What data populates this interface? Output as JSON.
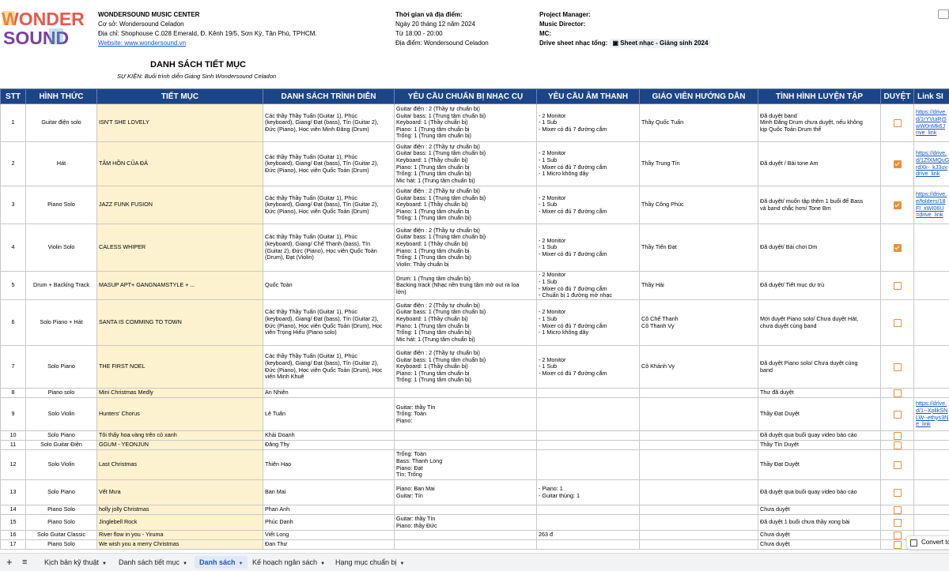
{
  "brand": {
    "logo_line1": "WONDER",
    "logo_line2": "SOUND"
  },
  "info": {
    "center_name": "WONDERSOUND MUSIC CENTER",
    "branch": "Cơ sở: Wondersound Celadon",
    "address": "Địa chỉ: Shophouse C.028 Emerald, Đ. Kênh 19/5, Sơn Kỳ, Tân Phú, TPHCM.",
    "website_label": "Website: ",
    "website": "www.wondersound.vn",
    "time_place_label": "Thời gian và địa điểm:",
    "date": "Ngày 20 tháng 12 năm 2024",
    "time": "Từ 18:00 - 20:00",
    "venue": "Địa điểm: Wondersound Celadon",
    "pm_label": "Project Manager:",
    "md_label": "Music Director:",
    "mc_label": "MC:",
    "drive_label": "Drive sheet nhạc tổng:",
    "drive_chip": "Sheet nhạc - Giáng sinh 2024"
  },
  "sheet_title": "DANH SÁCH TIẾT MỤC",
  "sheet_subtitle": "SỰ KIỆN: Buổi trình diễn Giáng Sinh Wondersound Celadon",
  "columns": [
    "STT",
    "HÌNH THỨC",
    "TIẾT MỤC",
    "DANH SÁCH TRÌNH DIỄN",
    "YÊU CẦU CHUẨN BỊ NHẠC CỤ",
    "YÊU CẦU ÂM THANH",
    "GIÁO VIÊN HƯỚNG DẪN",
    "TÌNH HÌNH LUYỆN TẬP",
    "DUYỆT",
    "Link SI"
  ],
  "rows": [
    {
      "stt": "1",
      "form": "Guitar điện solo",
      "piece": "ISN'T SHE LOVELY",
      "performers": "Các thầy Thầy Tuấn (Guitar 1), Phúc\n(keyboard), Giang/ Đạt (bass), Tín (Guitar 2),\nĐức (Piano), Học viên Minh Đăng (Drum)",
      "instruments": "Guitar điện : 2 (Thầy tự chuẩn bị)\nGuitar bass: 1 (Trung tâm chuẩn bị)\nKeyboard: 1 (Thầy chuẩn bị)\nPiano: 1 (Trung tâm chuẩn bị\nTrống: 1 (Trung tâm chuẩn bị)",
      "sound": "- 2 Monitor\n- 1 Sub\n- Mixer có đủ 7 đường cắm",
      "teacher": "Thầy Quốc Tuấn",
      "practice": "Đã duyệt band\nMinh Đăng Drum chưa duyệt, nếu không\nkịp Quốc Toản Drum thế",
      "approved": false,
      "link": "https://drive.\nd/1rYVuiRjS\nwW0nMk6J\nrive_link"
    },
    {
      "stt": "2",
      "form": "Hát",
      "piece": "TÂM HỒN CỦA ĐÁ",
      "performers": "Các thầy Thầy Tuấn (Guitar 1), Phúc\n(keyboard), Giang/ Đạt (bass), Tín (Guitar 2),\nĐức (Piano), Học viên Quốc Toản (Drum)",
      "instruments": "Guitar điện : 2 (Thầy tự chuẩn bị)\nGuitar bass: 1 (Trung tâm chuẩn bị)\nKeyboard: 1 (Thầy chuẩn bị)\nPiano: 1 (Trung tâm chuẩn bị\nTrống: 1 (Trung tâm chuẩn bị)\nMic hát: 1 (Trung tâm chuẩn bị)",
      "sound": "- 2 Monitor\n- 1 Sub\n- Mixer có đủ 7 đường cắm\n- 1 Micro không dây",
      "teacher": "Thầy Trung Tín",
      "practice": "Đã duyệt / Bài tone Am",
      "approved": true,
      "link": "https://drive.\nd/1ZfXMQuG\nrdXk-_kJ3uv\ndrive_link"
    },
    {
      "stt": "3",
      "form": "Piano Solo",
      "piece": "JAZZ FUNK FUSION",
      "performers": "Các thầy Thầy Tuấn (Guitar 1), Phúc\n(keyboard), Giang/ Đạt (bass), Tín (Guitar 2),\nĐức (Piano), Học viên Quốc Toản (Drum)",
      "instruments": "Guitar điện : 2 (Thầy tự chuẩn bị)\nGuitar bass: 1 (Trung tâm chuẩn bị)\nKeyboard: 1 (Thầy chuẩn bị)\nPiano: 1 (Trung tâm chuẩn bị\nTrống: 1 (Trung tâm chuẩn bị)",
      "sound": "- 2 Monitor\n- 1 Sub\n- Mixer có đủ 7 đường cắm",
      "teacher": "Thầy Công Phúc",
      "practice": "Đã duyệt/ muốn tập thêm 1 buổi để Bass\nvà band chắc hơn/ Tone Bm",
      "approved": true,
      "link": "https://drive.\ne/folders/18\nFl_xWI06U\n=drive_link"
    },
    {
      "stt": "4",
      "form": "Violin Solo",
      "piece": "CALESS WHIPER",
      "performers": "Các thầy Thầy Tuấn (Guitar 1), Phúc\n(keyboard), Giang/ Chế Thanh (bass), Tín\n(Guitar 2), Đức (Piano), Học viên Quốc Toản\n(Drum), Đạt (Violin)",
      "instruments": "Guitar điện : 2 (Thầy tự chuẩn bị)\nGuitar bass: 1 (Trung tâm chuẩn bị)\nKeyboard: 1 (Thầy chuẩn bị)\nPiano: 1 (Trung tâm chuẩn bị\nTrống: 1 (Trung tâm chuẩn bị)\nViolin: Thầy chuẩn bị",
      "sound": "- 2 Monitor\n- 1 Sub\n- Mixer có đủ 7 đường cắm",
      "teacher": "Thầy Tiến Đạt",
      "practice": "Đã duyệt/ Bài chơi Dm",
      "approved": true,
      "link": ""
    },
    {
      "stt": "5",
      "form": "Drum + Backing Track",
      "piece": "MASUP APT+ GANGNAMSTYLE + ...",
      "performers": "Quốc Toàn",
      "instruments": "Drum: 1 (Trung tâm chuẩn bị)\nBacking track (Nhạc nền trung tâm mở out ra loa\nlớn)",
      "sound": "- 2 Monitor\n- 1 Sub\n- Mixer có đủ 7 đường cắm\n- Chuẩn bị 1 đường mở nhạc",
      "teacher": "Thầy Hải",
      "practice": "Đã duyệt/ Tiết mục dự trù",
      "approved": false,
      "link": ""
    },
    {
      "stt": "6",
      "form": "Solo Piano + Hát",
      "piece": "SANTA IS COMMING TO TOWN",
      "performers": "Các thầy Thầy Tuấn (Guitar 1), Phúc\n(keyboard), Giang/ Đạt (bass), Tín (Guitar 2),\nĐức (Piano), Học viên Quốc Toản (Drum), Học\nviên Trọng Hiếu (Piano solo)",
      "instruments": "Guitar điện : 2 (Thầy tự chuẩn bị)\nGuitar bass: 1 (Trung tâm chuẩn bị)\nKeyboard: 1 (Thầy chuẩn bị)\nPiano: 1 (Trung tâm chuẩn bị\nTrống: 1 (Trung tâm chuẩn bị)\nMic hát: 1 (Trung tâm chuẩn bị)",
      "sound": "- 2 Monitor\n- 1 Sub\n- Mixer có đủ 7 đường cắm\n- 1 Micro không dây",
      "teacher": "Cô Chế Thanh\nCô Thanh Vy",
      "practice": "Mới duyệt Piano solo/ Chưa duyệt Hát,\nchưa duyệt cùng band",
      "approved": false,
      "link": ""
    },
    {
      "stt": "7",
      "form": "Solo Piano",
      "piece": "THE FIRST NOEL",
      "performers": "Các thầy Thầy Tuấn (Guitar 1), Phúc\n(keyboard), Giang/ Đạt (bass), Tín (Guitar 2),\nĐức (Piano), Học viên Quốc Toản (Drum), Học\nviên Minh Khuê",
      "instruments": "Guitar điện : 2 (Thầy tự chuẩn bị)\nGuitar bass: 1 (Trung tâm chuẩn bị)\nKeyboard: 1 (Thầy chuẩn bị)\nPiano: 1 (Trung tâm chuẩn bị\nTrống: 1 (Trung tâm chuẩn bị)",
      "sound": "- 2 Monitor\n- 1 Sub\n- Mixer có đủ 7 đường cắm",
      "teacher": "Cô Khánh Vy",
      "practice": "Đã duyệt Piano solo/ Chưa duyệt cùng\nband",
      "approved": false,
      "link": ""
    },
    {
      "stt": "8",
      "form": "Piano solo",
      "piece": "Mini Christmas Medly",
      "performers": "An Nhiên",
      "instruments": "",
      "sound": "",
      "teacher": "",
      "practice": "Thư đã duyệt",
      "approved": false,
      "link": ""
    },
    {
      "stt": "9",
      "form": "Solo Violin",
      "piece": "Hunters' Chorus",
      "performers": "Lê Tuấn",
      "instruments": "Guitar: thầy Tín\nTrống: Toàn\nPiano:",
      "sound": "",
      "teacher": "",
      "practice": "Thầy Đạt Duyệt",
      "approved": false,
      "link": "https://drive.\nd/1--XplikSN\nLW--ethys3N\ne_link"
    },
    {
      "stt": "10",
      "form": "Solo Piano",
      "piece": "Tôi thấy hoa vàng trên cỏ xanh",
      "performers": "Khải Doanh",
      "instruments": "",
      "sound": "",
      "teacher": "",
      "practice": "Đã duyệt qua buổi quay video báo cáo",
      "approved": false,
      "link": ""
    },
    {
      "stt": "11",
      "form": "Solo Guitar Điện",
      "piece": "GGUM - YEONJUN",
      "performers": "Đăng Thy",
      "instruments": "",
      "sound": "",
      "teacher": "",
      "practice": "Thầy Tín Duyệt",
      "approved": false,
      "link": ""
    },
    {
      "stt": "12",
      "form": "Solo Violin",
      "piece": "Last Christmas",
      "performers": "Thiên Hạo",
      "instruments": "Trống: Toàn\nBass: Thanh Long\nPiano: Đạt\nTín: Trống",
      "sound": "",
      "teacher": "",
      "practice": "Thầy Đạt Duyệt",
      "approved": false,
      "link": ""
    },
    {
      "stt": "13",
      "form": "Solo Piano",
      "piece": "Vết Mưa",
      "performers": "Ban Mai",
      "instruments": "Piano: Ban Mai\nGuitar: Tín",
      "sound": "- Piano: 1\n- Guitar thùng: 1",
      "teacher": "",
      "practice": "Đã duyệt qua buổi quay video báo cáo",
      "approved": false,
      "link": ""
    },
    {
      "stt": "14",
      "form": "Piano Solo",
      "piece": "holly jolly Christmas",
      "performers": "Phan Anh",
      "instruments": "",
      "sound": "",
      "teacher": "",
      "practice": "Chưa duyệt",
      "approved": false,
      "link": ""
    },
    {
      "stt": "15",
      "form": "Piano Solo",
      "piece": "Jinglebell Rock",
      "performers": "Phúc Danh",
      "instruments": "Guitar: thầy Tín\nPiano: thầy Đức",
      "sound": "",
      "teacher": "",
      "practice": "Đã duyệt 1 buổi chưa thầy xong bài",
      "approved": false,
      "link": ""
    },
    {
      "stt": "16",
      "form": "Solo Guitar Classic",
      "piece": "River flow in you - Yiruma",
      "performers": "Viết Long",
      "instruments": "",
      "sound": "263 đ",
      "teacher": "",
      "practice": "Chưa duyệt",
      "approved": false,
      "link": ""
    },
    {
      "stt": "17",
      "form": "Piano Solo",
      "piece": "We wish you a merry Christmas",
      "performers": "Đan Thư",
      "instruments": "",
      "sound": "",
      "teacher": "",
      "practice": "Chưa duyệt",
      "approved": false,
      "link": ""
    }
  ],
  "tabbar": {
    "add": "+",
    "tabs": [
      {
        "label": "Kịch bản kỹ thuật",
        "active": false
      },
      {
        "label": "Danh sách tiết mục",
        "active": false
      },
      {
        "label": "Danh sách",
        "active": true
      },
      {
        "label": "Kế hoạch ngân sách",
        "active": false
      },
      {
        "label": "Hạng mục chuẩn bị",
        "active": false
      }
    ]
  },
  "toast": {
    "label": "Convert to"
  },
  "colors": {
    "header_bg": "#1c4587",
    "highlight": "#fdf2cf",
    "checkbox": "#e69138",
    "link": "#1155cc"
  }
}
